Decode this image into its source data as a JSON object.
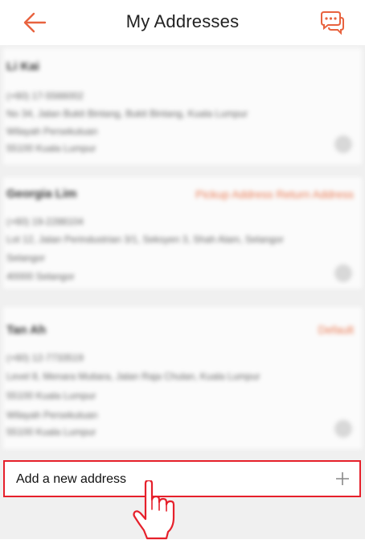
{
  "header": {
    "title": "My Addresses",
    "back_icon": "arrow-left-icon",
    "chat_icon": "chat-bubbles-icon"
  },
  "addresses": [
    {
      "name": "Li Kai",
      "tag": "",
      "lines": [
        "(+60) 17-5566002",
        "No 34, Jalan Bukit Bintang, Bukit Bintang, Kuala Lumpur",
        "Wilayah Persekutuan",
        "55100 Kuala Lumpur"
      ]
    },
    {
      "name": "Georgia Lim",
      "tag": "Pickup Address  Return Address",
      "lines": [
        "(+60) 19-2288104",
        "Lot 12, Jalan Perindustrian 3/1, Seksyen 3, Shah Alam, Selangor",
        "Selangor",
        "40000 Selangor"
      ]
    },
    {
      "name": "Tan Ah",
      "tag": "Default",
      "lines": [
        "(+60) 12-7733519",
        "Level 8, Menara Mutiara, Jalan Raja Chulan, Kuala Lumpur",
        "55100 Kuala Lumpur",
        "Wilayah Persekutuan",
        "55100 Kuala Lumpur"
      ]
    }
  ],
  "add_address": {
    "label": "Add a new address",
    "icon": "plus-icon"
  },
  "annotation": {
    "highlight_color": "#e6202b",
    "pointer_icon": "hand-pointer-icon"
  },
  "colors": {
    "accent": "#e8633f",
    "highlight": "#e6202b"
  }
}
